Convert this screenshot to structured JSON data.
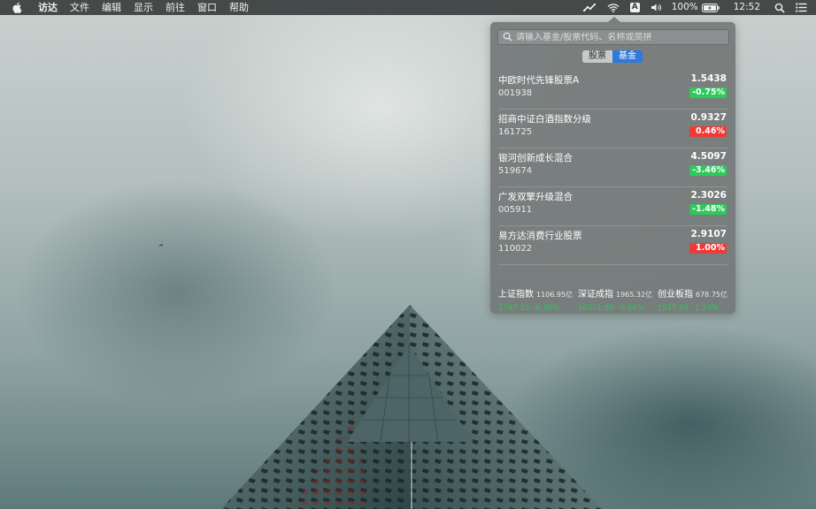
{
  "menubar": {
    "app_name": "访达",
    "menus": [
      "文件",
      "编辑",
      "显示",
      "前往",
      "窗口",
      "帮助"
    ],
    "input_method": "A",
    "battery": "100%",
    "time": "12:52"
  },
  "popover": {
    "search": {
      "placeholder": "请输入基金/股票代码、名称或简拼",
      "value": ""
    },
    "tabs": {
      "stock": "股票",
      "fund": "基金",
      "selected": "fund"
    },
    "funds": [
      {
        "name": "中欧时代先锋股票A",
        "code": "001938",
        "price": "1.5438",
        "change": "-0.75%",
        "direction": "down"
      },
      {
        "name": "招商中证白酒指数分级",
        "code": "161725",
        "price": "0.9327",
        "change": "0.46%",
        "direction": "up"
      },
      {
        "name": "银河创新成长混合",
        "code": "519674",
        "price": "4.5097",
        "change": "-3.46%",
        "direction": "down"
      },
      {
        "name": "广发双擎升级混合",
        "code": "005911",
        "price": "2.3026",
        "change": "-1.48%",
        "direction": "down"
      },
      {
        "name": "易方达消费行业股票",
        "code": "110022",
        "price": "2.9107",
        "change": "1.00%",
        "direction": "up"
      }
    ],
    "indices": [
      {
        "name": "上证指数",
        "volume": "1106.95亿",
        "value": "2797.29",
        "change": "-0.30%"
      },
      {
        "name": "深证成指",
        "volume": "1965.32亿",
        "value": "10351.80",
        "change": "-0.46%"
      },
      {
        "name": "创业板指",
        "volume": "678.75亿",
        "value": "1925.65",
        "change": "-1.24%"
      }
    ]
  },
  "colors": {
    "up": "#ee3a3a",
    "down": "#2ec95a",
    "accent": "#2f79d9",
    "index_text": "#2ec95a"
  }
}
